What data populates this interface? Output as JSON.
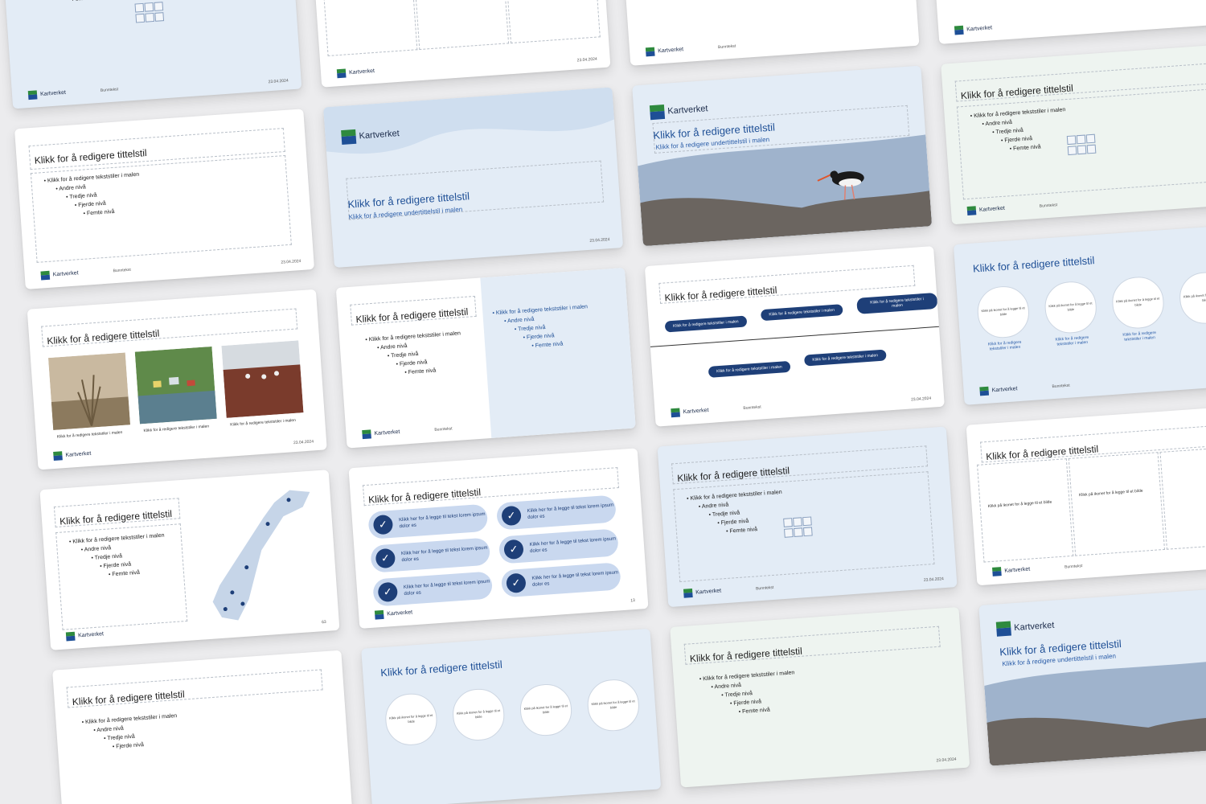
{
  "brand": {
    "name": "Kartverket",
    "colors": {
      "navy": "#1e3f78",
      "blue": "#1e4f96",
      "green": "#2e8a3e",
      "light_blue": "#e3ecf6"
    }
  },
  "strings": {
    "title": "Klikk for å redigere tittelstil",
    "subtitle": "Klikk for å redigere undertittelstil i malen",
    "level1": "Klikk for å redigere tekststiler i malen",
    "level2": "Andre nivå",
    "level3": "Tredje nivå",
    "level4": "Fjerde nivå",
    "level5": "Femte nivå",
    "picture_hint": "Klikk på ikonet for å legge til et bilde",
    "pill_text": "Klikk for å redigere tekststiler i malen",
    "check_text": "Klikk her for å legge til tekst lorem ipsum dolor es",
    "date": "23.04.2024",
    "footer_label": "Bunntekst",
    "page_number_a": "13",
    "page_number_b": "63"
  },
  "icons": [
    "table-icon",
    "chart-icon",
    "smartart-icon",
    "picture-icon",
    "online-picture-icon",
    "video-icon"
  ]
}
